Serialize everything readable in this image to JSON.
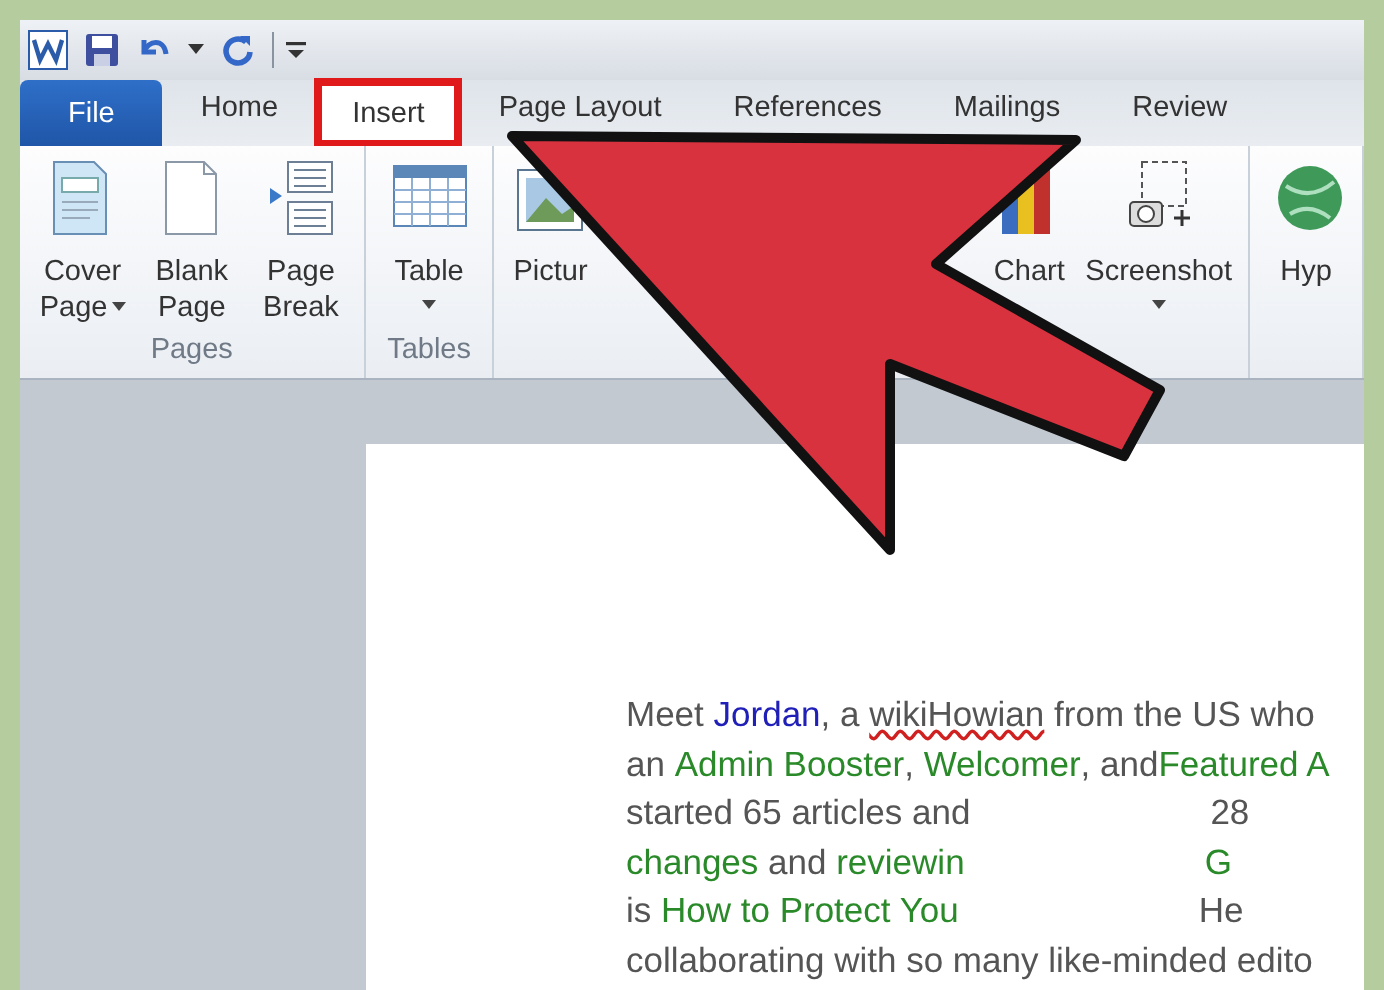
{
  "quick_access": {
    "items": [
      {
        "kind": "word"
      },
      {
        "kind": "save"
      },
      {
        "kind": "undo"
      },
      {
        "kind": "caret"
      },
      {
        "kind": "redo"
      },
      {
        "kind": "customize"
      }
    ]
  },
  "tabs": [
    {
      "label": "File",
      "kind": "file",
      "selected": false,
      "highlighted": false
    },
    {
      "label": "Home",
      "kind": "tab",
      "selected": false,
      "highlighted": false
    },
    {
      "label": "Insert",
      "kind": "tab",
      "selected": true,
      "highlighted": true
    },
    {
      "label": "Page Layout",
      "kind": "tab",
      "selected": false,
      "highlighted": false
    },
    {
      "label": "References",
      "kind": "tab",
      "selected": false,
      "highlighted": false
    },
    {
      "label": "Mailings",
      "kind": "tab",
      "selected": false,
      "highlighted": false
    },
    {
      "label": "Review",
      "kind": "tab",
      "selected": false,
      "highlighted": false
    }
  ],
  "ribbon": {
    "groups": [
      {
        "label": "Pages",
        "buttons": [
          {
            "kind": "cover",
            "label": "Cover Page",
            "dropdown": true
          },
          {
            "kind": "blank",
            "label": "Blank Page",
            "dropdown": false
          },
          {
            "kind": "pagebreak",
            "label": "Page Break",
            "dropdown": false
          }
        ]
      },
      {
        "label": "Tables",
        "buttons": [
          {
            "kind": "table",
            "label": "Table",
            "dropdown": true
          }
        ]
      },
      {
        "buttons": [
          {
            "kind": "picture",
            "label": "Pictur",
            "dropdown": false
          },
          {
            "kind": "chart",
            "label": "Chart",
            "dropdown": false
          },
          {
            "kind": "screenshot",
            "label": "Screenshot",
            "dropdown": true
          }
        ]
      },
      {
        "buttons": [
          {
            "kind": "hyperlink",
            "label": "Hyp",
            "dropdown": false
          }
        ]
      }
    ]
  },
  "document": {
    "lines": [
      [
        {
          "kind": "text",
          "text": "Meet "
        },
        {
          "kind": "name",
          "text": "Jordan"
        },
        {
          "kind": "text",
          "text": ", a "
        },
        {
          "kind": "misspelled",
          "text": "wikiHowian"
        },
        {
          "kind": "text",
          "text": " from the US who"
        }
      ],
      [
        {
          "kind": "text",
          "text": "an "
        },
        {
          "kind": "link",
          "text": "Admin Booster"
        },
        {
          "kind": "text",
          "text": ", "
        },
        {
          "kind": "link",
          "text": "Welcomer"
        },
        {
          "kind": "text",
          "text": ", and"
        },
        {
          "kind": "link",
          "text": "Featured A"
        }
      ],
      [
        {
          "kind": "text",
          "text": "started 65 articles and"
        },
        {
          "kind": "gap"
        },
        {
          "kind": "text",
          "text": "28"
        }
      ],
      [
        {
          "kind": "link",
          "text": "changes"
        },
        {
          "kind": "text",
          "text": " and "
        },
        {
          "kind": "link",
          "text": "reviewin"
        },
        {
          "kind": "gap"
        },
        {
          "kind": "link",
          "text": "G"
        }
      ],
      [
        {
          "kind": "text",
          "text": "is "
        },
        {
          "kind": "link",
          "text": "How to Protect You"
        },
        {
          "kind": "gap"
        },
        {
          "kind": "text",
          "text": "He"
        }
      ],
      [
        {
          "kind": "text",
          "text": "collaborating with so many like-minded edito"
        }
      ]
    ]
  }
}
